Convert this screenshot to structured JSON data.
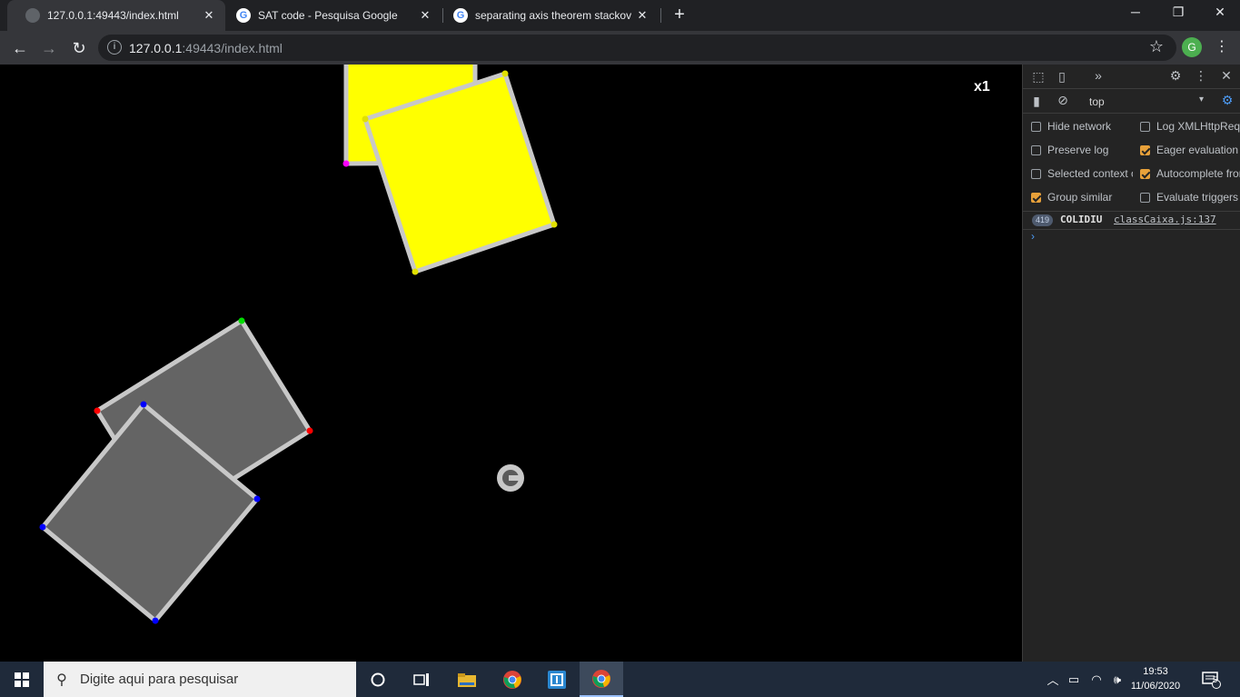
{
  "browser": {
    "tabs": [
      {
        "title": "127.0.0.1:49443/index.html",
        "favicon": "globe-icon",
        "active": true
      },
      {
        "title": "SAT code - Pesquisa Google",
        "favicon": "google-icon",
        "active": false
      },
      {
        "title": "separating axis theorem stackove",
        "favicon": "google-icon",
        "active": false
      }
    ],
    "url_host": "127.0.0.1",
    "url_rest": ":49443/index.html",
    "profile_initial": "G"
  },
  "page": {
    "zoom_label": "x1",
    "background": "#000000",
    "shapes": [
      {
        "name": "yellow-box-back",
        "fill": "#ffff00",
        "stroke": "#c8c8c8"
      },
      {
        "name": "yellow-box-front",
        "fill": "#ffff00",
        "stroke": "#c8c8c8"
      },
      {
        "name": "gray-box-back",
        "fill": "#646464",
        "stroke": "#c8c8c8"
      },
      {
        "name": "gray-box-front",
        "fill": "#646464",
        "stroke": "#c8c8c8"
      }
    ],
    "vertex_colors": {
      "magenta": "#ff00ff",
      "yellow": "#e0e000",
      "green": "#00dd00",
      "red": "#ff0000",
      "blue": "#0000ff"
    }
  },
  "devtools": {
    "context": "top",
    "options_left": [
      {
        "label": "Hide network",
        "checked": false
      },
      {
        "label": "Preserve log",
        "checked": false
      },
      {
        "label": "Selected context only",
        "checked": false
      },
      {
        "label": "Group similar",
        "checked": true
      }
    ],
    "options_right": [
      {
        "label": "Log XMLHttpRequests",
        "checked": false
      },
      {
        "label": "Eager evaluation",
        "checked": true
      },
      {
        "label": "Autocomplete from history",
        "checked": true
      },
      {
        "label": "Evaluate triggers user activation",
        "checked": false
      }
    ],
    "log": {
      "count": "419",
      "message": "COLIDIU",
      "source": "classCaixa.js:137"
    },
    "prompt": "›"
  },
  "taskbar": {
    "search_placeholder": "Digite aqui para pesquisar",
    "time": "19:53",
    "date": "11/06/2020",
    "notification_count": "5"
  }
}
